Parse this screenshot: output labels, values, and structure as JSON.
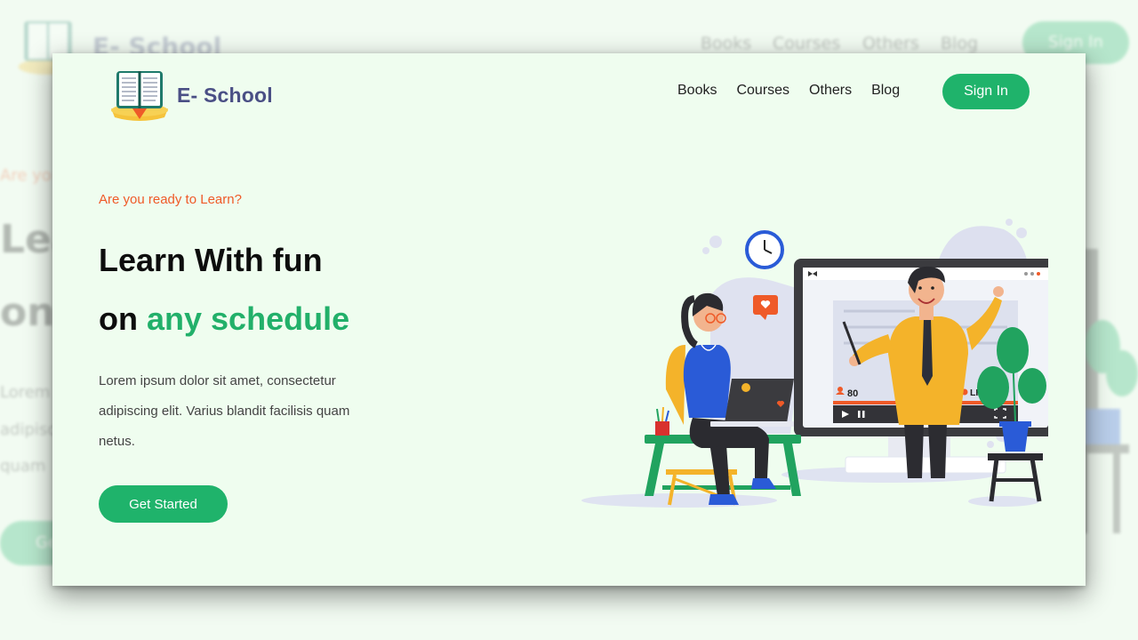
{
  "brand": {
    "name": "E- School",
    "logo_icon": "open-book-icon"
  },
  "nav": {
    "items": [
      {
        "label": "Books"
      },
      {
        "label": "Courses"
      },
      {
        "label": "Others"
      },
      {
        "label": "Blog"
      }
    ],
    "signin_label": "Sign In"
  },
  "hero": {
    "tagline": "Are you ready to Learn?",
    "headline_line1": "Learn With fun",
    "headline_prefix": "on",
    "headline_accent": "any schedule",
    "description": "Lorem ipsum dolor sit amet, consectetur adipiscing elit. Varius blandit facilisis quam netus.",
    "cta_label": "Get Started"
  },
  "illustration": {
    "view_count": "80",
    "live_label": "LIVE",
    "icons": [
      "clock-icon",
      "heart-icon",
      "play-icon",
      "pause-icon",
      "fullscreen-icon"
    ]
  },
  "background": {
    "logo_text": "E- School",
    "nav": [
      "Books",
      "Courses",
      "Others",
      "Blog"
    ],
    "signin": "Sign In",
    "tagline_fragment": "Are yo",
    "head_fragment_1": "Lea",
    "head_fragment_2": "on",
    "desc_fragments": [
      "Lorem",
      "adipisc",
      "quam"
    ],
    "cta_fragment": "Ge"
  },
  "colors": {
    "accent_green": "#1fb36b",
    "tagline_orange": "#ef5a28",
    "brand_navy": "#4a4f85",
    "page_bg": "#effdef"
  }
}
